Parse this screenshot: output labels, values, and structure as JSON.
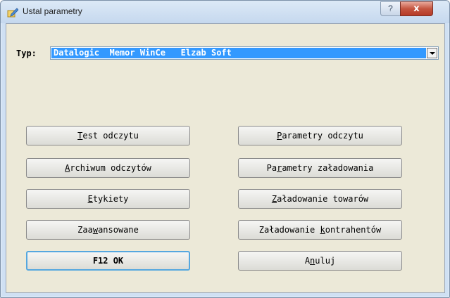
{
  "window": {
    "title": "Ustal parametry",
    "help_label": "?",
    "close_label": "x",
    "app_icon": "edit-pencil-icon"
  },
  "type_selector": {
    "label": "Typ:",
    "value": "Datalogic  Memor WinCe   Elzab Soft"
  },
  "buttons": {
    "test_read": {
      "pre": "",
      "key": "T",
      "post": "est odczytu"
    },
    "read_params": {
      "pre": "",
      "key": "P",
      "post": "arametry odczytu"
    },
    "archive": {
      "pre": "",
      "key": "A",
      "post": "rchiwum odczytów"
    },
    "load_params": {
      "pre": "Pa",
      "key": "r",
      "post": "ametry załadowania"
    },
    "labels": {
      "pre": "",
      "key": "E",
      "post": "tykiety"
    },
    "load_goods": {
      "pre": "",
      "key": "Z",
      "post": "aładowanie towarów"
    },
    "advanced": {
      "pre": "Zaa",
      "key": "w",
      "post": "ansowane"
    },
    "load_contractors": {
      "pre": "Załadowanie ",
      "key": "k",
      "post": "ontrahentów"
    },
    "ok": {
      "label": "F12 OK"
    },
    "cancel": {
      "pre": "A",
      "key": "n",
      "post": "uluj"
    }
  },
  "colors": {
    "selection": "#3399ff",
    "dialog_bg": "#ece9d8",
    "default_button_border": "#55a7df",
    "close_button": "#c45540"
  }
}
